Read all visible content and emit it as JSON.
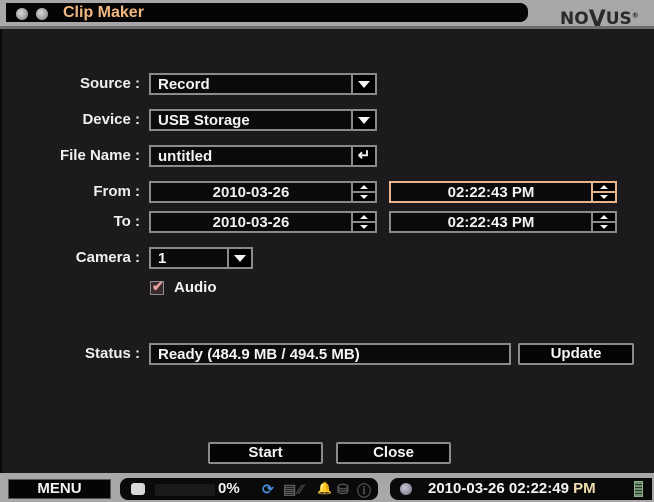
{
  "window": {
    "title": "Clip Maker",
    "brand": "NOVUS"
  },
  "form": {
    "source": {
      "label": "Source :",
      "value": "Record"
    },
    "device": {
      "label": "Device :",
      "value": "USB Storage"
    },
    "file_name": {
      "label": "File Name :",
      "value": "untitled",
      "enter_icon": "↵"
    },
    "from": {
      "label": "From :",
      "date": "2010-03-26",
      "time": "02:22:43 PM"
    },
    "to": {
      "label": "To :",
      "date": "2010-03-26",
      "time": "02:22:43 PM"
    },
    "camera": {
      "label": "Camera :",
      "value": "1"
    },
    "audio": {
      "label": "Audio",
      "checked": true,
      "check_glyph": "✔"
    },
    "status": {
      "label": "Status :",
      "value": "Ready  (484.9 MB / 494.5 MB)"
    },
    "update_label": "Update"
  },
  "buttons": {
    "start": "Start",
    "close": "Close"
  },
  "taskbar": {
    "menu_label": "MENU",
    "progress_percent": "0%",
    "progress_value": 0,
    "icons": [
      "disk-icon",
      "sync-icon",
      "hdd-stack-icon",
      "network-off-icon",
      "alarm-bell-icon",
      "storage-icon",
      "warning-icon"
    ],
    "glyphs": {
      "sync": "⟳",
      "stack": "▤",
      "net": "⁄⁄",
      "bell": "🔔",
      "storage": "⛁",
      "warn": "ⓘ"
    },
    "datetime": "2010-03-26 02:22:49",
    "ampm": "PM"
  }
}
